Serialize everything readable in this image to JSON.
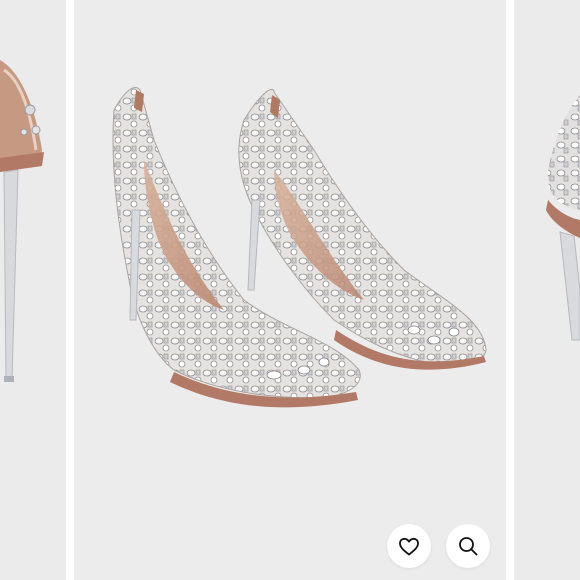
{
  "carousel": {
    "current_image": "product-photo-shoe-pair",
    "previous_image": "product-photo-shoe-side",
    "next_image": "product-photo-shoe-back"
  },
  "actions": {
    "like_icon": "heart-outline-icon",
    "zoom_icon": "magnifier-icon"
  },
  "colors": {
    "background": "#ffffff",
    "photo_bg": "#edecec",
    "nude": "#c9a08a",
    "crystal": "#d9d9dc",
    "icon": "#111111"
  }
}
